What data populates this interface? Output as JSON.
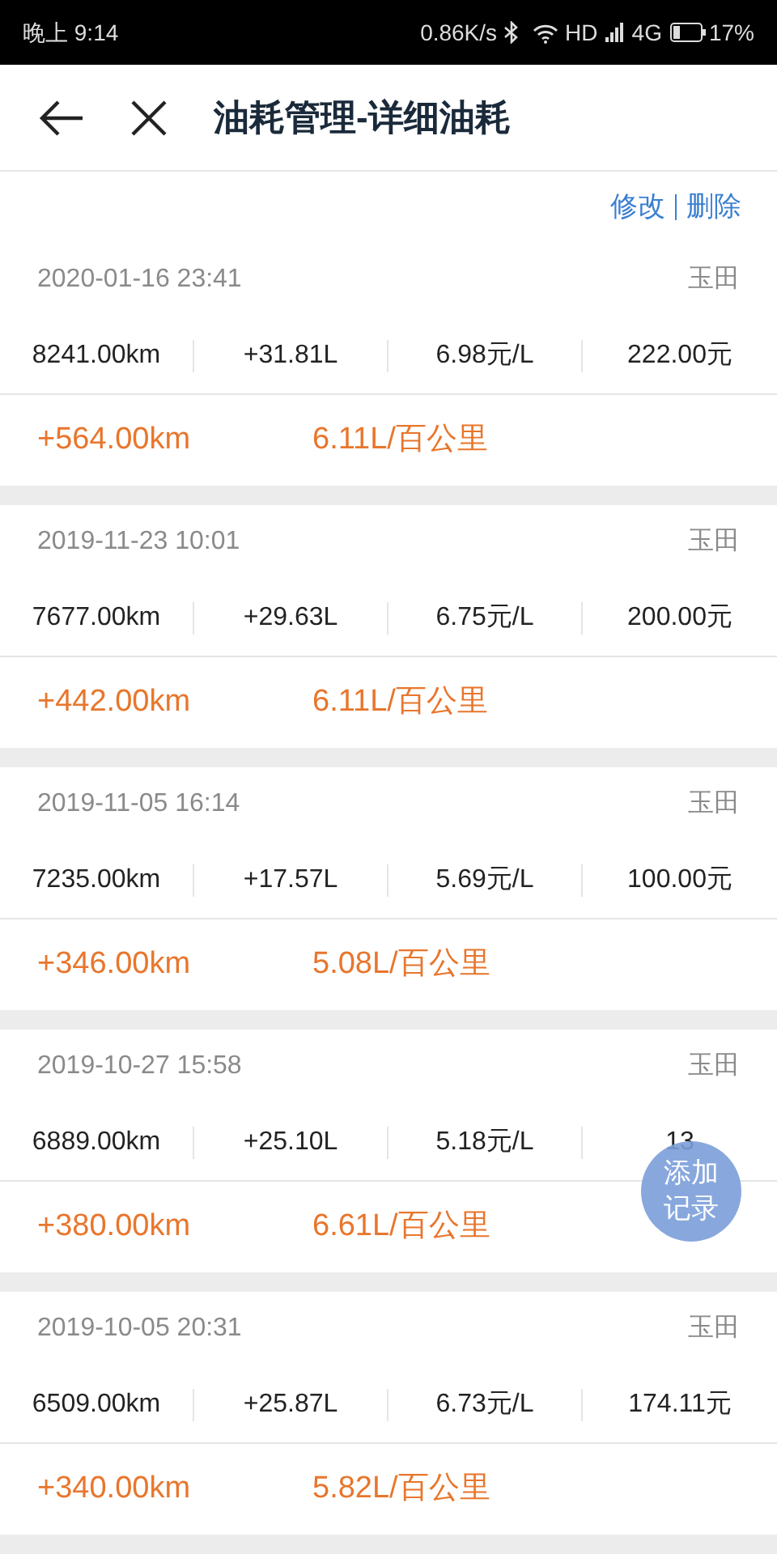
{
  "status_bar": {
    "time": "晚上 9:14",
    "speed": "0.86K/s",
    "hd": "HD",
    "network": "4G",
    "battery": "17%"
  },
  "header": {
    "title": "油耗管理-详细油耗"
  },
  "actions": [
    "修改",
    "删除"
  ],
  "records": [
    {
      "date": "2020-01-16 23:41",
      "car": "玉田",
      "odometer": "8241.00km",
      "fuel": "+31.81L",
      "price": "6.98元/L",
      "amount": "222.00元",
      "distance": "+564.00km",
      "consumption": "6.11L/百公里"
    },
    {
      "date": "2019-11-23 10:01",
      "car": "玉田",
      "odometer": "7677.00km",
      "fuel": "+29.63L",
      "price": "6.75元/L",
      "amount": "200.00元",
      "distance": "+442.00km",
      "consumption": "6.11L/百公里"
    },
    {
      "date": "2019-11-05 16:14",
      "car": "玉田",
      "odometer": "7235.00km",
      "fuel": "+17.57L",
      "price": "5.69元/L",
      "amount": "100.00元",
      "distance": "+346.00km",
      "consumption": "5.08L/百公里"
    },
    {
      "date": "2019-10-27 15:58",
      "car": "玉田",
      "odometer": "6889.00km",
      "fuel": "+25.10L",
      "price": "5.18元/L",
      "amount": "13",
      "distance": "+380.00km",
      "consumption": "6.61L/百公里"
    },
    {
      "date": "2019-10-05 20:31",
      "car": "玉田",
      "odometer": "6509.00km",
      "fuel": "+25.87L",
      "price": "6.73元/L",
      "amount": "174.11元",
      "distance": "+340.00km",
      "consumption": "5.82L/百公里"
    }
  ],
  "fab": {
    "label": "添加记录"
  }
}
